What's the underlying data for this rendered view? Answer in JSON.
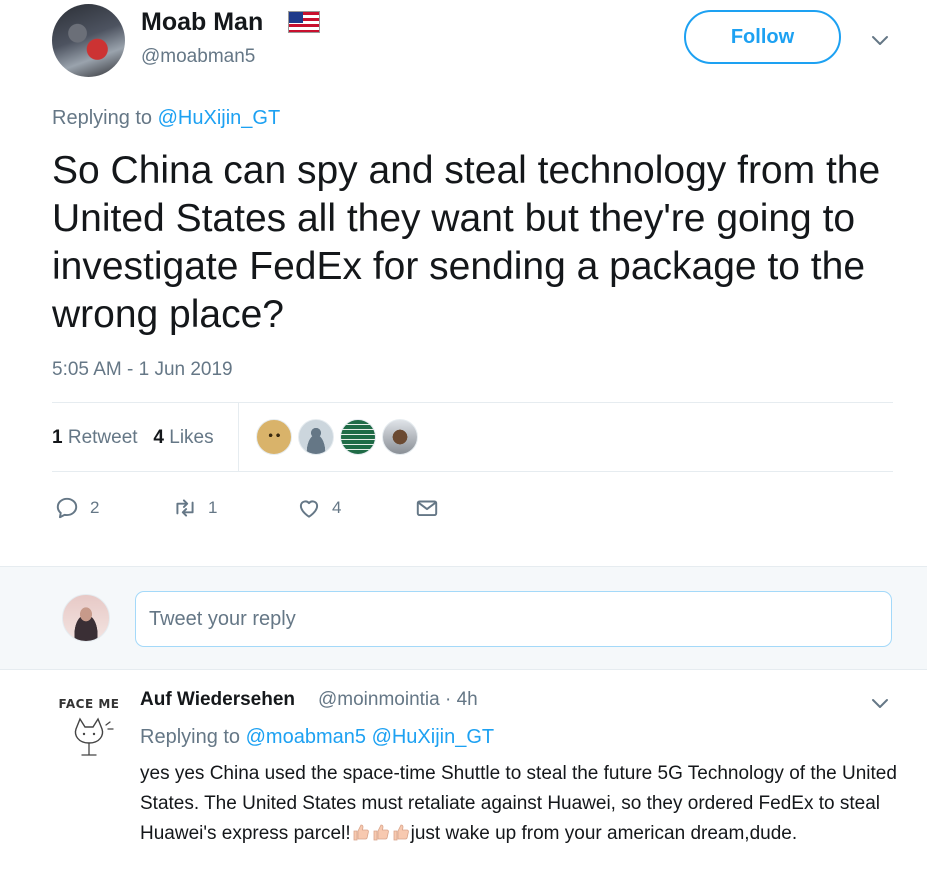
{
  "tweet": {
    "display_name": "Moab Man",
    "handle": "@moabman5",
    "follow_label": "Follow",
    "replying_prefix": "Replying to ",
    "replying_to": "@HuXijin_GT",
    "text": "So China can spy and steal technology from the United States all they want but they're going to investigate FedEx for sending a package to the wrong place?",
    "timestamp": "5:05 AM - 1 Jun 2019",
    "retweet_count": "1",
    "retweet_label": "Retweet",
    "like_count": "4",
    "like_label": "Likes",
    "actions": {
      "reply_count": "2",
      "retweet_count": "1",
      "like_count": "4"
    }
  },
  "reply_box": {
    "placeholder": "Tweet your reply"
  },
  "reply": {
    "avatar_text": "FACE ME",
    "display_name": "Auf Wiedersehen",
    "handle_time": "@moinmointia · 4h",
    "replying_prefix": "Replying to ",
    "replying_to_1": "@moabman5",
    "replying_to_2": "@HuXijin_GT",
    "text_before": "yes yes China used the space-time Shuttle to steal the future 5G Technology of the United States. The United States must retaliate against Huawei, so they ordered FedEx to steal Huawei's express parcel!",
    "text_after": "just wake up from your american dream,dude."
  },
  "colors": {
    "accent": "#1da1f2",
    "secondary_text": "#657786",
    "primary_text": "#14171a",
    "reply_bg": "#f5f8fa"
  }
}
